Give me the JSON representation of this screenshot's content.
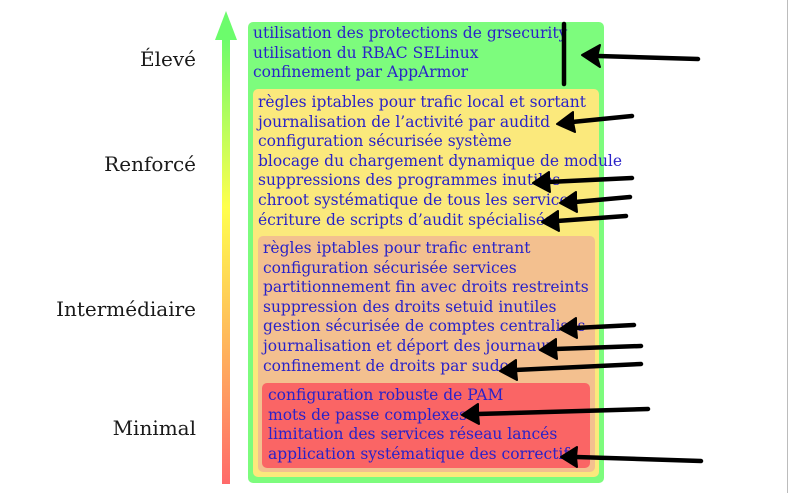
{
  "levels": {
    "high": "Élevé",
    "reinforced": "Renforcé",
    "intermediate": "Intermédiaire",
    "minimal": "Minimal"
  },
  "boxes": {
    "high": {
      "color": "#7dfc7d",
      "items": [
        "utilisation des protections de grsecurity",
        "utilisation du RBAC SELinux",
        "confinement par AppArmor"
      ]
    },
    "reinforced": {
      "color": "#fbe97c",
      "items": [
        "règles iptables pour trafic local et sortant",
        "journalisation de l’activité par auditd",
        "configuration sécurisée système",
        "blocage du chargement dynamique de module",
        "suppressions des programmes inutiles",
        "chroot systématique de tous les services",
        "écriture de scripts d’audit spécialisés"
      ]
    },
    "intermediate": {
      "color": "#f3c08f",
      "items": [
        "règles iptables pour trafic entrant",
        "configuration sécurisée services",
        "partitionnement fin avec droits restreints",
        "suppression des droits setuid inutiles",
        "gestion sécurisée de comptes centralisés",
        "journalisation et déport des journaux",
        "confinement de droits par sudo"
      ]
    },
    "minimal": {
      "color": "#fa6565",
      "items": [
        "configuration robuste de PAM",
        "mots de passe complexes",
        "limitation des services réseau lancés",
        "application systématique des correctifs"
      ]
    }
  },
  "gradient_colors": [
    "#ff6a6a",
    "#ffff4d",
    "#6cfc6c"
  ],
  "arrow_color": "#000000"
}
